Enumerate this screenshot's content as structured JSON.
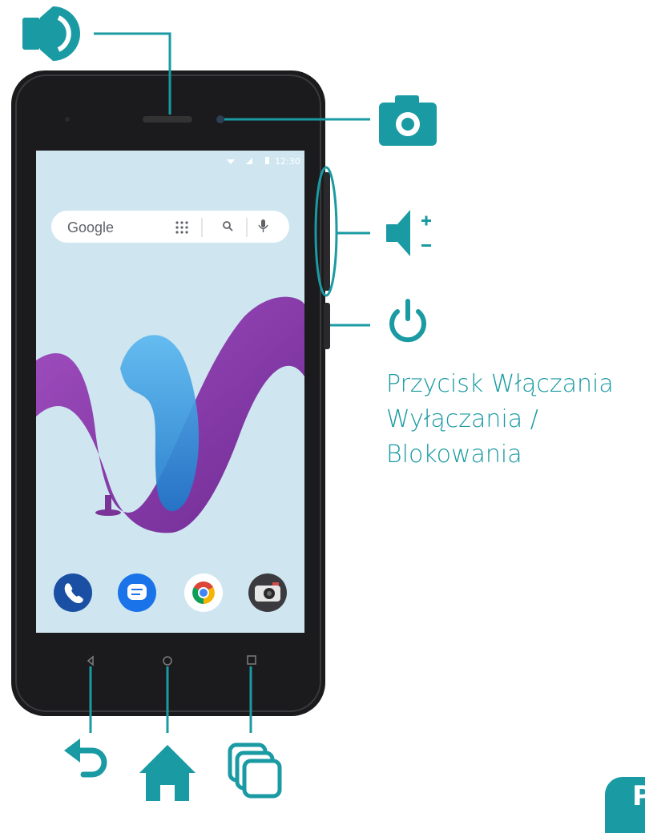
{
  "status_bar": {
    "time": "12:30"
  },
  "search_bar": {
    "brand": "Google"
  },
  "power_button_label": {
    "line1": "Przycisk Włączania",
    "line2": "Wyłączania /",
    "line3": "Blokowania"
  },
  "page_marker": "P",
  "colors": {
    "accent": "#1a9aa3",
    "phone_body": "#1b1b1d",
    "screen_bg": "#cfe6f1",
    "logo_purple": "#8a3aa8",
    "logo_blue": "#2b8fe0"
  },
  "icons": {
    "speaker": "speaker-icon",
    "camera": "camera-icon",
    "volume": "volume-icon",
    "power": "power-icon",
    "back": "back-arrow-icon",
    "home": "home-icon",
    "recents": "recent-apps-icon",
    "dock": [
      "phone-app-icon",
      "messages-app-icon",
      "chrome-app-icon",
      "camera-app-icon"
    ]
  }
}
